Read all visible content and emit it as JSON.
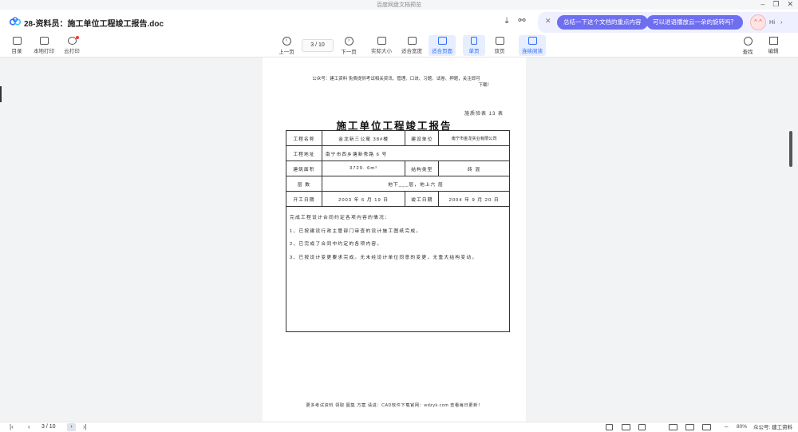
{
  "window": {
    "title": "百度网盘文档预览"
  },
  "doc": {
    "title": "28-资料员：施工单位工程竣工报告.doc"
  },
  "assistant": {
    "suggestion_1": "总结一下这个文档的重点内容",
    "suggestion_2": "可以进语播放云一朵的旋转吗？",
    "greeting": "Hi",
    "avatar_text": "^ ^"
  },
  "toolbar": {
    "left": [
      {
        "label": "目录",
        "icon": "outline-icon"
      },
      {
        "label": "本地打印",
        "icon": "print-icon"
      },
      {
        "label": "云打印",
        "icon": "cloud-print-icon"
      }
    ],
    "prev_label": "上一页",
    "next_label": "下一页",
    "page_indicator": "3 / 10",
    "view_modes": [
      {
        "label": "实际大小",
        "active": false
      },
      {
        "label": "适合宽度",
        "active": false
      },
      {
        "label": "适合页面",
        "active": true
      },
      {
        "label": "单页",
        "active": true
      },
      {
        "label": "双页",
        "active": false
      },
      {
        "label": "连续阅读",
        "active": true
      }
    ],
    "right": [
      {
        "label": "查找",
        "icon": "search-icon"
      },
      {
        "label": "编辑",
        "icon": "edit-icon"
      }
    ]
  },
  "page": {
    "header_line_1": "公众号：建工资料  免费提供考试相关资讯、管理、口诀、习题、试卷、押题，关注即可",
    "header_line_2": "下载！",
    "form_code": "施质验表 13 表",
    "title": "施工单位工程竣工报告",
    "rows": {
      "project_name_label": "工程名称",
      "project_name_value": "金龙新三公寓 38#楼",
      "builder_label": "建设单位",
      "builder_value": "南宁市金龙实业有限公司",
      "address_label": "工程地址",
      "address_value": "南宁市西乡塘新秀路 6 号",
      "area_label": "建筑面积",
      "area_value": "3729. 6m²",
      "structure_label": "结构类型",
      "structure_value": "砖    混",
      "floors_label": "层        数",
      "floors_value": "地下___层，地上六  层",
      "start_label": "开工日期",
      "start_value": "2003 年 6 月 19 日",
      "finish_label": "竣工日期",
      "finish_value": "2004 年 9 月 20 日"
    },
    "desc_title": "完成工程设计合同约定各项内容的情况：",
    "desc_1": "1、已按建设行政主管部门审查的设计施工图纸完成。",
    "desc_2": "2、已完成了合同中约定的各项内容。",
    "desc_3": "3、已按设计变更要求完成。无未经设计单位同意的变更，无重大结构变动。",
    "footer": "更多考试资料  领取  图集  方案  请进：CAD软件下载官网：wdzyk.com  查看每日更新！"
  },
  "bottom": {
    "page_indicator": "3 / 10",
    "zoom": "80%",
    "watermark": "众公号: 建工资料"
  }
}
